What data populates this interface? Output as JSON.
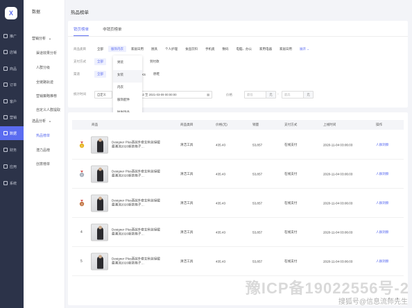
{
  "rail": {
    "logo": "X",
    "items": [
      {
        "label": "推广",
        "icon": "megaphone-icon"
      },
      {
        "label": "店铺",
        "icon": "store-icon"
      },
      {
        "label": "商品",
        "icon": "goods-icon"
      },
      {
        "label": "订单",
        "icon": "order-icon"
      },
      {
        "label": "客户",
        "icon": "customer-icon"
      },
      {
        "label": "营销",
        "icon": "marketing-icon"
      },
      {
        "label": "数据",
        "icon": "data-icon"
      },
      {
        "label": "财务",
        "icon": "finance-icon"
      },
      {
        "label": "应用",
        "icon": "apps-icon"
      },
      {
        "label": "系统",
        "icon": "settings-icon"
      }
    ],
    "active_index": 6
  },
  "side": {
    "title": "数据",
    "group1": "营销分析",
    "group1_items": [
      "渠道效果分析",
      "人群分级",
      "全链路轨迹",
      "营销策略推荐",
      "自定义人群提取"
    ],
    "group2": "选品分析",
    "group2_items": [
      "热品榜单",
      "潜力品榜",
      "创意榜单"
    ]
  },
  "page": {
    "title": "热品榜单"
  },
  "filter": {
    "tabs": [
      "销页榜单",
      "非销页榜单"
    ],
    "category_label": "商品类目",
    "category_options": [
      "全部",
      "服饰内衣",
      "家居日用",
      "厨具",
      "个人护理",
      "食品饮料",
      "手机类",
      "数码",
      "电脑、办公",
      "家用电器",
      "家居日用"
    ],
    "expand": "展开",
    "pay_label": "支付方式",
    "pay_options": [
      "全部",
      "到付款"
    ],
    "channel_label": "渠道",
    "channel_options": [
      "全部",
      "XS",
      "原鞋"
    ],
    "dropdown": [
      "男装",
      "女装",
      "内衣",
      "服饰配件",
      "时尚饰品"
    ],
    "time_label": "统计时间",
    "time_mode": "自定义",
    "time_range": "2021-03-09 15:59:52 至 2021-03-09 00:00:00",
    "price_label": "价格",
    "price_min_ph": "最低",
    "price_max_ph": "最高",
    "unit": "元",
    "dash": "-"
  },
  "table": {
    "headers": [
      "商品",
      "商品类目",
      "价格(元)",
      "销量",
      "支付方式",
      "上线时间",
      "操作"
    ],
    "rows": [
      {
        "rank": "1",
        "medal": "gold",
        "name": "Designer Plus西装外套女秋装保暖最潮流2020新款格子…",
        "category": "清洁工具",
        "price": "435.43",
        "sales": "53,857",
        "pay": "在线支付",
        "time": "2020-11-04 03:06:03",
        "action": "人群洞察"
      },
      {
        "rank": "2",
        "medal": "silver",
        "name": "Designer Plus西装外套女秋装保暖最潮流2020新款格子…",
        "category": "清洁工具",
        "price": "435.43",
        "sales": "53,857",
        "pay": "在线支付",
        "time": "2020-11-04 03:06:03",
        "action": "人群洞察"
      },
      {
        "rank": "3",
        "medal": "bronze",
        "name": "Designer Plus西装外套女秋装保暖最潮流2020新款格子…",
        "category": "清洁工具",
        "price": "435.43",
        "sales": "53,857",
        "pay": "在线支付",
        "time": "2020-11-04 03:06:03",
        "action": "人群洞察"
      },
      {
        "rank": "4",
        "medal": "",
        "name": "Designer Plus西装外套女秋装保暖最潮流2020新款格子…",
        "category": "清洁工具",
        "price": "435.43",
        "sales": "53,857",
        "pay": "在线支付",
        "time": "2020-11-04 03:06:03",
        "action": "人群洞察"
      },
      {
        "rank": "5",
        "medal": "",
        "name": "Designer Plus西装外套女秋装保暖最潮流2020新款格子…",
        "category": "清洁工具",
        "price": "435.43",
        "sales": "53,857",
        "pay": "在线支付",
        "time": "2020-11-04 03:06:03",
        "action": "人群洞察"
      }
    ]
  },
  "pager": {
    "prev": "‹",
    "next": "›"
  },
  "watermark": {
    "main": "豫ICP备19022556号-2",
    "sub": "搜狐号@信息流师先生"
  },
  "colors": {
    "accent": "#5b6cf0",
    "rail": "#2c3349",
    "gold": "#e6b422",
    "silver": "#aab2bd",
    "bronze": "#c47a4a"
  }
}
